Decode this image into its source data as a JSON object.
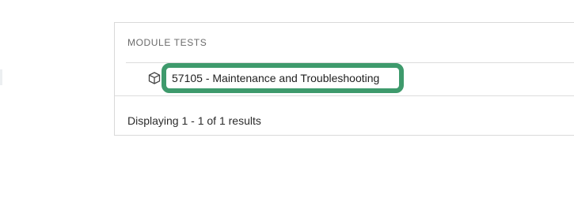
{
  "panel": {
    "header": "MODULE TESTS",
    "rows": [
      {
        "icon": "box-icon",
        "label": "57105 - Maintenance and Troubleshooting",
        "highlight_color": "#3e9a6c"
      }
    ],
    "footer": "Displaying 1 - 1 of 1 results"
  }
}
